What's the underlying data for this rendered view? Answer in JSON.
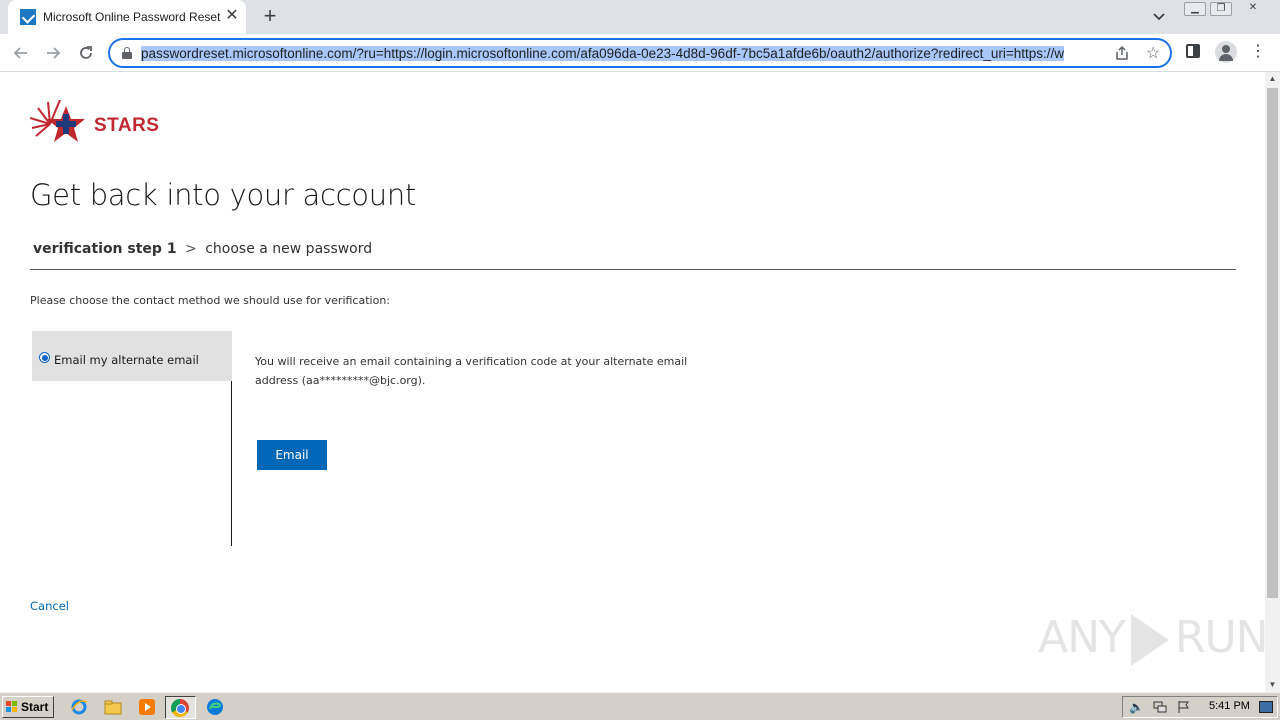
{
  "browser": {
    "tab_title": "Microsoft Online Password Reset",
    "tab_close": "✕",
    "new_tab": "+",
    "url": "passwordreset.microsoftonline.com/?ru=https://login.microsoftonline.com/afa096da-0e23-4d8d-96df-7bc5a1afde6b/oauth2/authorize?redirect_uri=https://w",
    "icons": {
      "back": "arrow-left-icon",
      "forward": "arrow-right-icon",
      "reload": "reload-icon",
      "lock": "lock-icon",
      "share": "share-icon",
      "bookmark": "star-icon",
      "side_panel": "side-panel-icon",
      "profile": "profile-icon",
      "menu": "kebab-menu-icon"
    },
    "accent_color": "#1a73e8"
  },
  "page": {
    "logo_text": "STARS",
    "title": "Get back into your account",
    "steps": {
      "current": "verification step 1",
      "separator": ">",
      "next": "choose a new password"
    },
    "prompt": "Please choose the contact method we should use for verification:",
    "methods": [
      {
        "label": "Email my alternate email",
        "selected": true
      }
    ],
    "method_description": "You will receive an email containing a verification code at your alternate email address (aa*********@bjc.org).",
    "email_button": "Email",
    "cancel_link": "Cancel",
    "link_color": "#0067b8",
    "brand_color": "#c0282f"
  },
  "watermark": {
    "left": "ANY",
    "right": "RUN"
  },
  "taskbar": {
    "start_label": "Start",
    "clock": "5:41 PM",
    "pinned": [
      "ie-icon",
      "explorer-folder-icon",
      "media-player-icon",
      "chrome-icon",
      "edge-icon"
    ],
    "tray": [
      "volume-icon",
      "network-icon",
      "flag-icon",
      "show-desktop-icon"
    ]
  }
}
